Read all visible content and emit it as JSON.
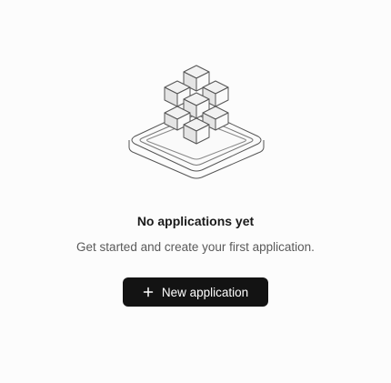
{
  "empty_state": {
    "illustration_icon": "stacked-cubes-icon",
    "title": "No applications yet",
    "subtitle": "Get started and create your first application.",
    "button": {
      "icon": "plus-icon",
      "label": "New application"
    }
  },
  "colors": {
    "background": "#fcfcfc",
    "button_background": "#131313",
    "button_text": "#ffffff",
    "title_text": "#1a1a1a",
    "subtitle_text": "#5a5a5a",
    "illustration_stroke": "#555555",
    "illustration_fill": "#eeeeee"
  }
}
